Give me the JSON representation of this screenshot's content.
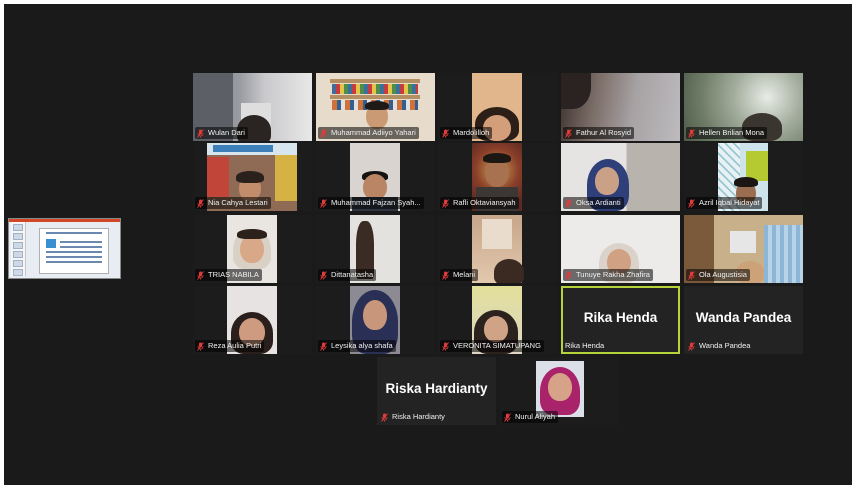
{
  "meeting": {
    "layout": "gallery-view",
    "active_speaker_color": "#b4d43a",
    "muted_icon": "mic-muted-icon",
    "muted_icon_color": "#e03c3c"
  },
  "shared_screen": {
    "content": "slide-presentation-thumbnail"
  },
  "participants": [
    {
      "name": "Wulan Dari",
      "muted": true
    },
    {
      "name": "Muhammad Adiiyo Yahari",
      "muted": true
    },
    {
      "name": "Mardolilloh",
      "muted": true
    },
    {
      "name": "Fathur Al Rosyid",
      "muted": true
    },
    {
      "name": "Hellen Brilian Mona",
      "muted": true
    },
    {
      "name": "Nia Cahya Lestari",
      "muted": true
    },
    {
      "name": "Muhammad Fajzan Syah...",
      "muted": true
    },
    {
      "name": "Rafli Oktaviansyah",
      "muted": true
    },
    {
      "name": "Oksa Ardianti",
      "muted": true
    },
    {
      "name": "Azril Iqbal Hidayat",
      "muted": true
    },
    {
      "name": "TRIAS NABILA",
      "muted": true
    },
    {
      "name": "Dittanatasha",
      "muted": true
    },
    {
      "name": "Melani",
      "muted": true
    },
    {
      "name": "Tunuye Rakha Zhafira",
      "muted": true
    },
    {
      "name": "Ola Augustisia",
      "muted": true
    },
    {
      "name": "Reza Aulia Putri",
      "muted": true
    },
    {
      "name": "Leysika alya shafa",
      "muted": true
    },
    {
      "name": "VERONITA SIMATUPANG",
      "muted": true
    },
    {
      "name": "Rika Henda",
      "muted": false,
      "video_off": true,
      "display_name": "Rika Henda"
    },
    {
      "name": "Wanda Pandea",
      "muted": true,
      "video_off": true,
      "display_name": "Wanda Pandea"
    },
    {
      "name": "Riska Hardianty",
      "muted": true,
      "video_off": true,
      "display_name": "Riska Hardianty"
    },
    {
      "name": "Nurul Aliyah",
      "muted": true
    }
  ]
}
